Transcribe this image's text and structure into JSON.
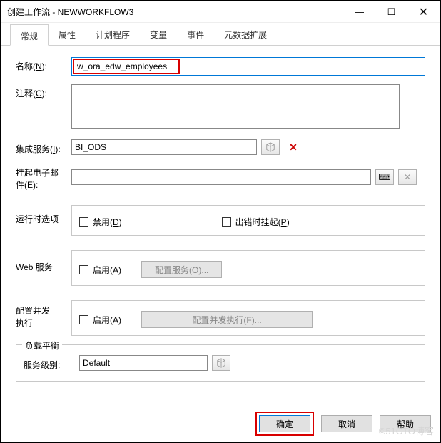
{
  "titlebar": {
    "title": "创建工作流 - NEWWORKFLOW3"
  },
  "tabs": {
    "items": [
      {
        "label": "常规"
      },
      {
        "label": "属性"
      },
      {
        "label": "计划程序"
      },
      {
        "label": "变量"
      },
      {
        "label": "事件"
      },
      {
        "label": "元数据扩展"
      }
    ]
  },
  "form": {
    "name": {
      "label": "名称(N):",
      "value": "w_ora_edw_employees"
    },
    "comment": {
      "label": "注释(C):",
      "value": ""
    },
    "integrationService": {
      "label": "集成服务(I):",
      "value": "BI_ODS"
    },
    "suspendEmail": {
      "label1": "挂起电子邮",
      "label2": "件(E):",
      "value": ""
    },
    "runtimeOptions": {
      "label": "运行时选项",
      "disable": "禁用(D)",
      "suspendOnError": "出错时挂起(P)"
    },
    "webService": {
      "label": "Web 服务",
      "enable": "启用(A)",
      "configBtn": "配置服务(O)..."
    },
    "concurrent": {
      "label1": "配置并发",
      "label2": "执行",
      "enable": "启用(A)",
      "configBtn": "配置并发执行(F)..."
    },
    "loadBalancing": {
      "legend": "负载平衡",
      "serviceLevel": {
        "label": "服务级别:",
        "value": "Default"
      }
    }
  },
  "buttons": {
    "ok": "确定",
    "cancel": "取消",
    "help": "帮助"
  },
  "watermark": "©51CTO博客"
}
